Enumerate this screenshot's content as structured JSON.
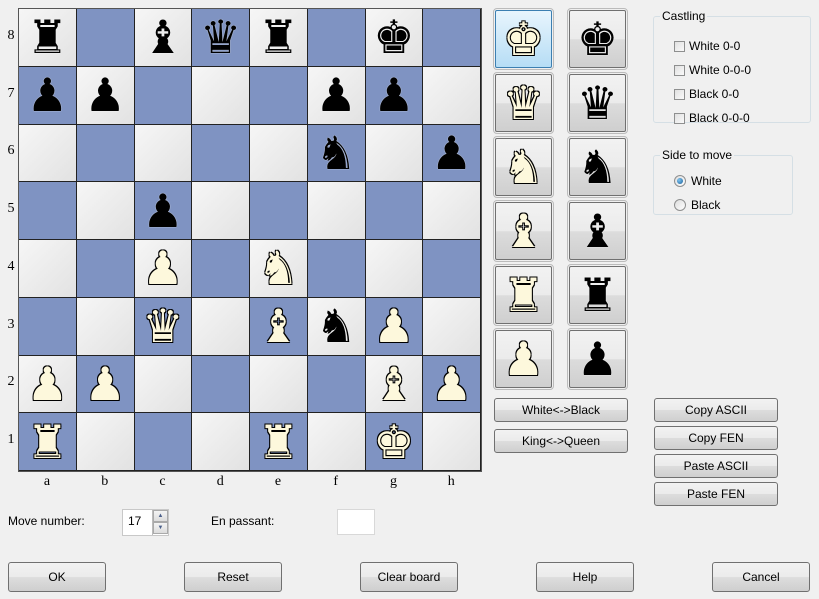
{
  "board": {
    "ranks": [
      "8",
      "7",
      "6",
      "5",
      "4",
      "3",
      "2",
      "1"
    ],
    "files": [
      "a",
      "b",
      "c",
      "d",
      "e",
      "f",
      "g",
      "h"
    ],
    "position": [
      [
        "bR",
        "",
        "bB",
        "bQ",
        "bR",
        "",
        "bK",
        ""
      ],
      [
        "bP",
        "bP",
        "",
        "",
        "",
        "bP",
        "bP",
        ""
      ],
      [
        "",
        "",
        "",
        "",
        "",
        "bN",
        "",
        "bP"
      ],
      [
        "",
        "",
        "bP",
        "",
        "",
        "",
        "",
        ""
      ],
      [
        "",
        "",
        "wP",
        "",
        "wN",
        "",
        "",
        ""
      ],
      [
        "",
        "",
        "wQ",
        "",
        "wB",
        "bN",
        "wP",
        ""
      ],
      [
        "wP",
        "wP",
        "",
        "",
        "",
        "",
        "wB",
        "wP"
      ],
      [
        "wR",
        "",
        "",
        "",
        "wR",
        "",
        "wK",
        ""
      ]
    ],
    "colors": {
      "light": "#e8e8e8",
      "dark": "#7f93c2"
    }
  },
  "piece_glyphs": {
    "K": "♚",
    "Q": "♛",
    "R": "♜",
    "B": "♝",
    "N": "♞",
    "P": "♟"
  },
  "palette": {
    "rows": [
      {
        "white": "wK",
        "black": "bK",
        "name": "king"
      },
      {
        "white": "wQ",
        "black": "bQ",
        "name": "queen"
      },
      {
        "white": "wN",
        "black": "bN",
        "name": "knight"
      },
      {
        "white": "wB",
        "black": "bB",
        "name": "bishop"
      },
      {
        "white": "wR",
        "black": "bR",
        "name": "rook"
      },
      {
        "white": "wP",
        "black": "bP",
        "name": "pawn"
      }
    ],
    "selected": "wK"
  },
  "castling": {
    "title": "Castling",
    "options": [
      {
        "label": "White 0-0",
        "checked": false
      },
      {
        "label": "White 0-0-0",
        "checked": false
      },
      {
        "label": "Black 0-0",
        "checked": false
      },
      {
        "label": "Black 0-0-0",
        "checked": false
      }
    ]
  },
  "side_to_move": {
    "title": "Side to move",
    "options": [
      {
        "label": "White",
        "selected": true
      },
      {
        "label": "Black",
        "selected": false
      }
    ]
  },
  "transform_buttons": {
    "swap_colors": "White<->Black",
    "swap_wings": "King<->Queen"
  },
  "clipboard_buttons": {
    "copy_ascii": "Copy ASCII",
    "copy_fen": "Copy FEN",
    "paste_ascii": "Paste ASCII",
    "paste_fen": "Paste FEN"
  },
  "move_number": {
    "label": "Move number:",
    "value": "17"
  },
  "en_passant": {
    "label": "En passant:",
    "value": ""
  },
  "dialog_buttons": {
    "ok": "OK",
    "reset": "Reset",
    "clear": "Clear board",
    "help": "Help",
    "cancel": "Cancel"
  }
}
